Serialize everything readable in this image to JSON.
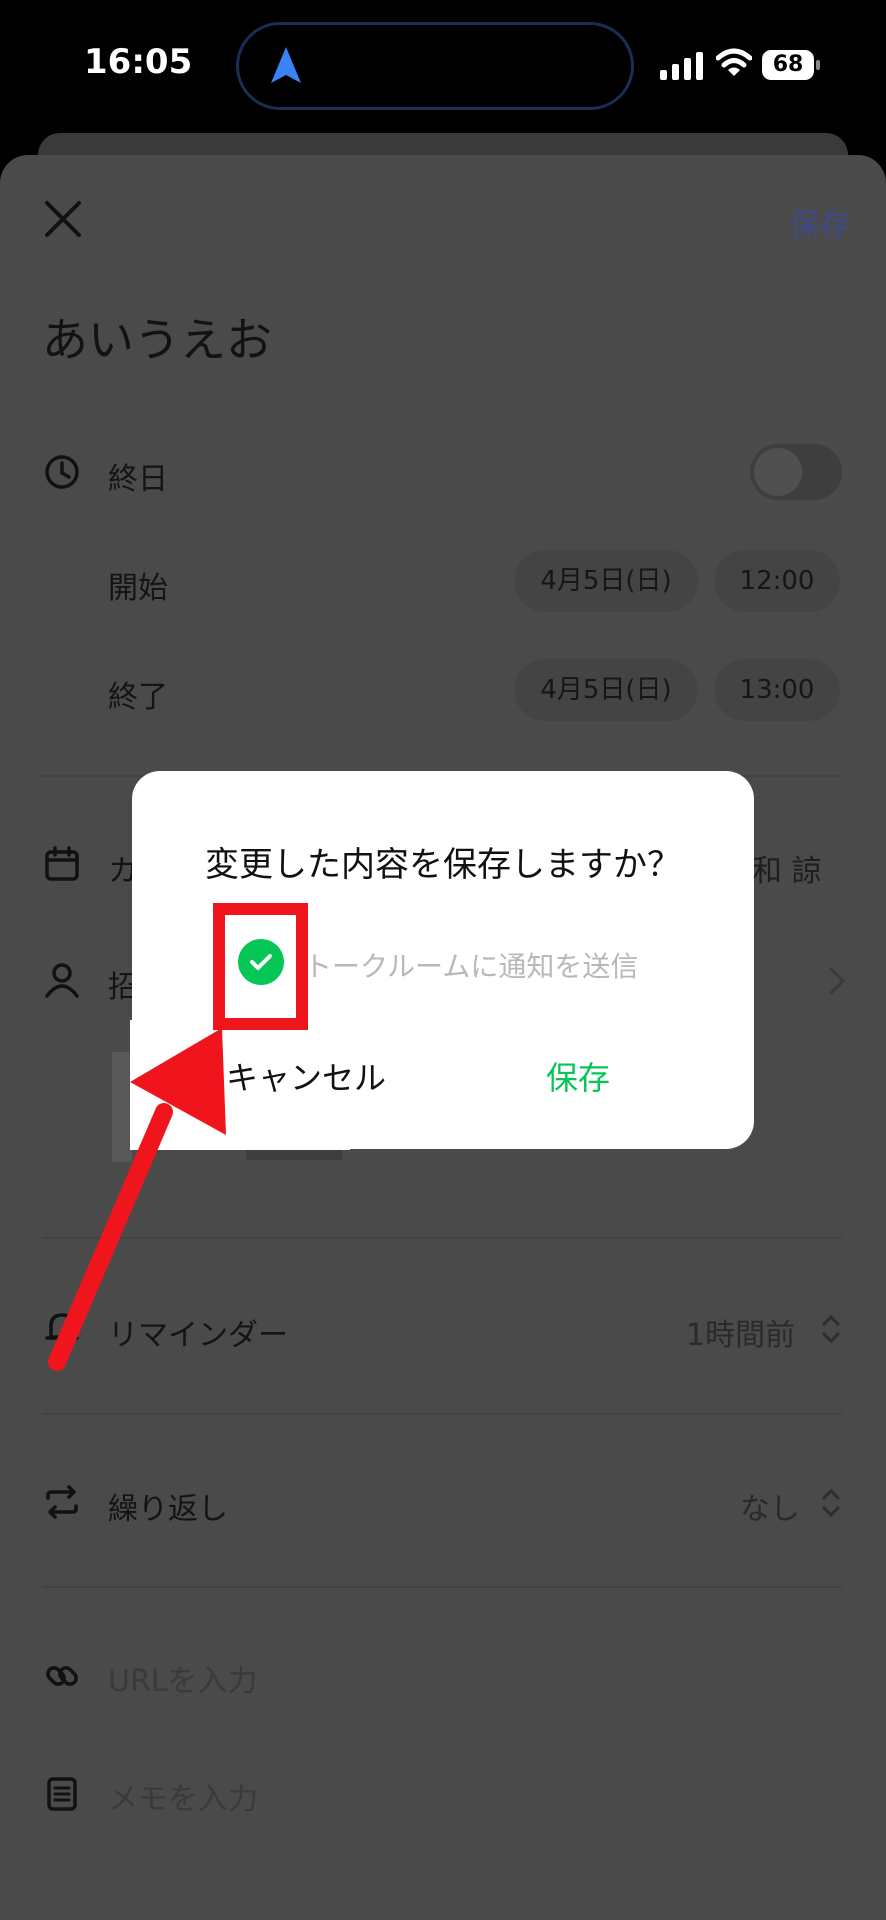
{
  "status_bar": {
    "time": "16:05",
    "battery": "68"
  },
  "header": {
    "save_label": "保存"
  },
  "event": {
    "title": "あいうえお"
  },
  "all_day": {
    "label": "終日",
    "enabled": false
  },
  "start": {
    "label": "開始",
    "date": "4月5日(日)",
    "time": "12:00"
  },
  "end": {
    "label": "終了",
    "date": "4月5日(日)",
    "time": "13:00"
  },
  "calendar": {
    "label_partial": "カ",
    "right_text": "和 諒"
  },
  "invite": {
    "label_partial": "招"
  },
  "reminder": {
    "label": "リマインダー",
    "value": "1時間前"
  },
  "repeat": {
    "label": "繰り返し",
    "value": "なし"
  },
  "url": {
    "placeholder": "URLを入力"
  },
  "memo": {
    "placeholder": "メモを入力"
  },
  "dialog": {
    "title": "変更した内容を保存しますか？",
    "notify_label": "トークルームに通知を送信",
    "notify_checked": true,
    "cancel_label": "キャンセル",
    "save_label": "保存"
  },
  "colors": {
    "accent_green": "#06c755",
    "annotation_red": "#f0151c",
    "link_blue": "#3c4a8c"
  }
}
